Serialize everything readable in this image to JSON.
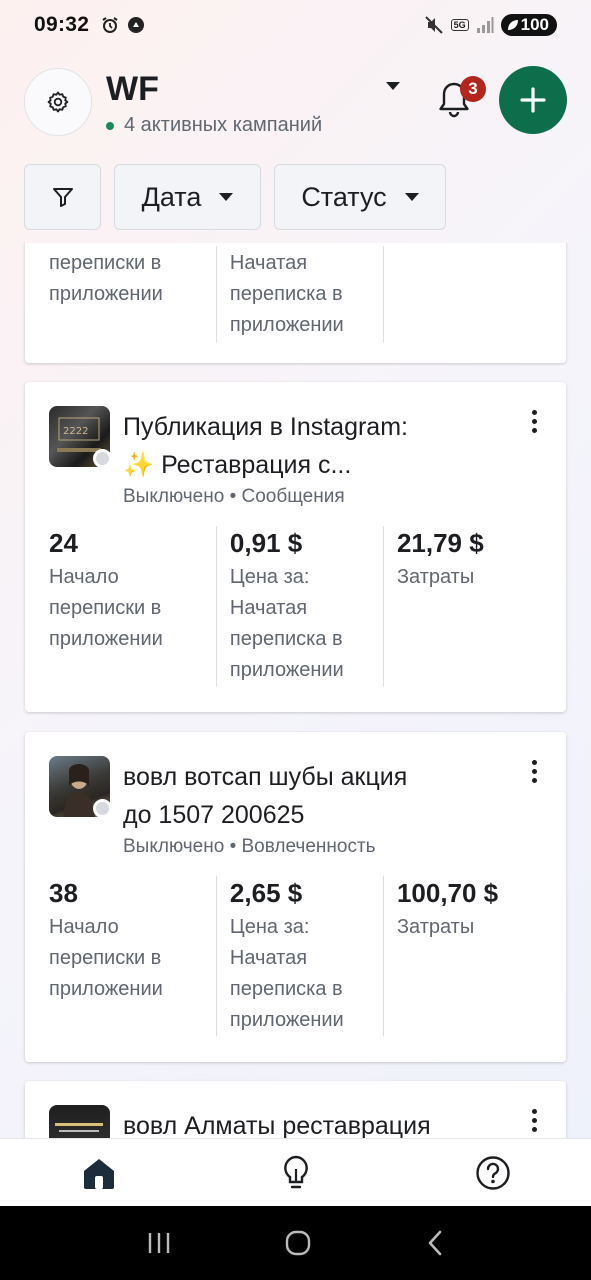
{
  "status_bar": {
    "time": "09:32",
    "network": "5G",
    "battery": "100"
  },
  "header": {
    "account_name": "WF",
    "active_campaigns": "4 активных кампаний",
    "notifications_count": "3"
  },
  "filters": {
    "date_label": "Дата",
    "status_label": "Статус"
  },
  "campaigns": [
    {
      "metrics": [
        {
          "value": "",
          "label_lines": [
            "переписки в",
            "приложении"
          ]
        },
        {
          "value": "",
          "label_lines": [
            "Начатая",
            "переписка в",
            "приложении"
          ]
        },
        {
          "value": "",
          "label_lines": []
        }
      ]
    },
    {
      "title_line1": "Публикация в Instagram:",
      "title_line2": "✨ Реставрация с...",
      "meta": "Выключено • Сообщения",
      "metrics": [
        {
          "value": "24",
          "label_lines": [
            "Начало",
            "переписки в",
            "приложении"
          ]
        },
        {
          "value": "0,91 $",
          "label_lines": [
            "Цена за:",
            "Начатая",
            "переписка в",
            "приложении"
          ]
        },
        {
          "value": "21,79 $",
          "label_lines": [
            "Затраты"
          ]
        }
      ]
    },
    {
      "title_line1": "вовл вотсап шубы акция",
      "title_line2": "до 1507 200625",
      "meta": "Выключено • Вовлеченность",
      "metrics": [
        {
          "value": "38",
          "label_lines": [
            "Начало",
            "переписки в",
            "приложении"
          ]
        },
        {
          "value": "2,65 $",
          "label_lines": [
            "Цена за:",
            "Начатая",
            "переписка в",
            "приложении"
          ]
        },
        {
          "value": "100,70 $",
          "label_lines": [
            "Затраты"
          ]
        }
      ]
    },
    {
      "title_line1": "вовл Алматы реставрация"
    }
  ],
  "colors": {
    "primary_green": "#0d6e4c",
    "badge_red": "#b3261e",
    "active_dot": "#1b8a5a"
  }
}
